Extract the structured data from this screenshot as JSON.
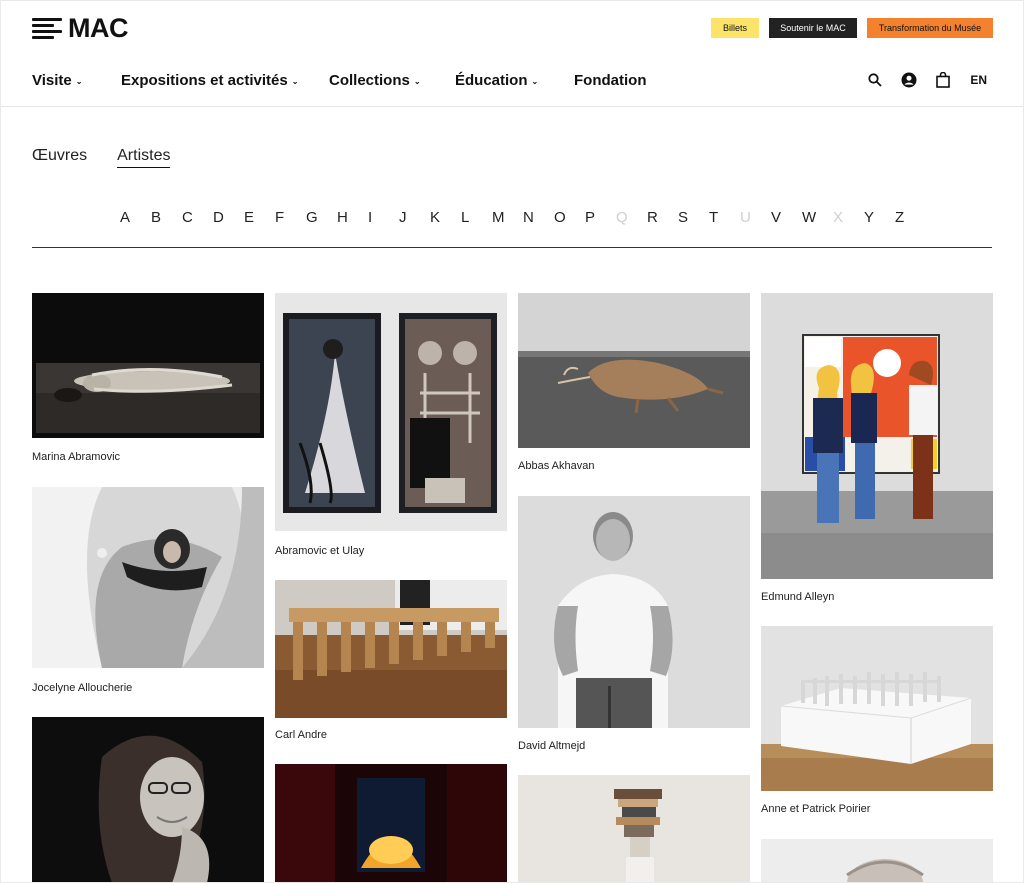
{
  "header": {
    "logo_text": "MAC",
    "buttons": {
      "billets": "Billets",
      "soutenir": "Soutenir le MAC",
      "transformation": "Transformation du Musée"
    },
    "nav": [
      {
        "label": "Visite",
        "has_dropdown": true
      },
      {
        "label": "Expositions et activités",
        "has_dropdown": true
      },
      {
        "label": "Collections",
        "has_dropdown": true
      },
      {
        "label": "Éducation",
        "has_dropdown": true
      },
      {
        "label": "Fondation",
        "has_dropdown": false
      }
    ],
    "icons": [
      "search-icon",
      "account-icon",
      "bag-icon"
    ],
    "lang": "EN"
  },
  "tabs": [
    {
      "label": "Œuvres",
      "active": false
    },
    {
      "label": "Artistes",
      "active": true
    }
  ],
  "alphabet": {
    "letters": [
      "A",
      "B",
      "C",
      "D",
      "E",
      "F",
      "G",
      "H",
      "I",
      "J",
      "K",
      "L",
      "M",
      "N",
      "O",
      "P",
      "Q",
      "R",
      "S",
      "T",
      "U",
      "V",
      "W",
      "X",
      "Y",
      "Z"
    ],
    "disabled": [
      "Q",
      "U",
      "X"
    ]
  },
  "artists": [
    {
      "name": "Marina Abramovic"
    },
    {
      "name": "Jocelyne Alloucherie"
    },
    {
      "name": ""
    },
    {
      "name": "Abramovic et Ulay"
    },
    {
      "name": "Carl Andre"
    },
    {
      "name": ""
    },
    {
      "name": "Abbas Akhavan"
    },
    {
      "name": "David Altmejd"
    },
    {
      "name": ""
    },
    {
      "name": "Edmund Alleyn"
    },
    {
      "name": "Anne et Patrick Poirier"
    },
    {
      "name": ""
    }
  ],
  "colors": {
    "billets": "#fce36a",
    "soutenir": "#222222",
    "transformation": "#f4812e"
  }
}
